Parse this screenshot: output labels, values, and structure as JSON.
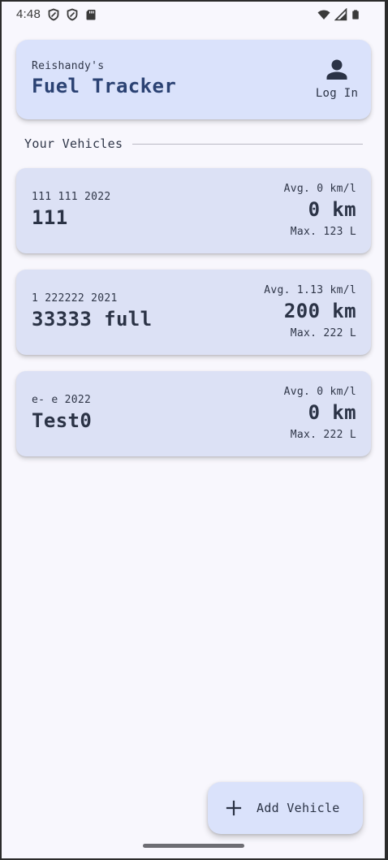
{
  "status_bar": {
    "time": "4:48",
    "left_icons": [
      "shield-icon",
      "shield-icon",
      "sd-card-icon"
    ],
    "right_icons": [
      "wifi-icon",
      "signal-icon",
      "battery-icon"
    ]
  },
  "header": {
    "subtitle": "Reishandy's",
    "title": "Fuel Tracker",
    "login_label": "Log In",
    "login_icon": "person-icon"
  },
  "section": {
    "title": "Your Vehicles"
  },
  "vehicles": [
    {
      "subtitle": "111 111 2022",
      "name": "111",
      "avg": "Avg. 0 km/l",
      "distance": "0 km",
      "max": "Max. 123 L"
    },
    {
      "subtitle": "1 222222 2021",
      "name": "33333 full",
      "avg": "Avg. 1.13 km/l",
      "distance": "200 km",
      "max": "Max. 222 L"
    },
    {
      "subtitle": "e- e 2022",
      "name": "Test0",
      "avg": "Avg. 0 km/l",
      "distance": "0 km",
      "max": "Max. 222 L"
    }
  ],
  "fab": {
    "label": "Add Vehicle",
    "icon": "plus-icon"
  },
  "colors": {
    "background": "#f8f7fd",
    "card": "#dce1f5",
    "header_card": "#dae2fb",
    "title_accent": "#2b4273",
    "text": "#2b3346"
  }
}
